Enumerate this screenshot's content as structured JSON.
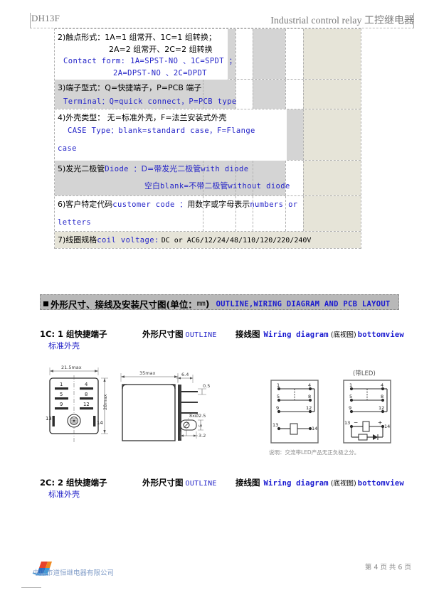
{
  "header": {
    "model": "DH13F",
    "title_en": "Industrial control relay",
    "title_cn": "工控继电器"
  },
  "spec_table": {
    "rows": [
      {
        "id": "contact-form",
        "cn_line1": "2)触点形式：1A=1 组常开、1C=1 组转换；",
        "cn_line2": "2A=2 组常开、2C=2 组转换",
        "en_line1": "Contact form:  1A=SPST-NO 、1C=SPDT ；",
        "en_line2": "2A=DPST-NO 、2C=DPDT"
      },
      {
        "id": "terminal-type",
        "cn_line1": "3)端子型式：Q=快捷端子，P=PCB 端子",
        "en_line1": "Terminal：Q=quick connect，P=PCB type"
      },
      {
        "id": "case-type",
        "cn_line1": "4)外壳类型： 无=标准外壳，F=法兰安装式外壳",
        "en_line1": "CASE Type：blank=standard case，F=Flange",
        "en_line2": "case"
      },
      {
        "id": "diode",
        "cn_line1": "5)发光二极管",
        "en_inline1": "Diode ：",
        "cn_line1b": "D=带发光二极管",
        "en_inline2": "with diode",
        "cn_line2": "空白",
        "en_line2a": "blank=",
        "cn_line2b": "不带二极管",
        "en_line2b": "without diode"
      },
      {
        "id": "customer-code",
        "cn_line1": "6)客户特定代码",
        "en_inline1": "customer code ：",
        "cn_line1b": "用数字或字母表示",
        "en_inline2": "numbers or",
        "en_line2": "letters"
      },
      {
        "id": "coil-voltage",
        "cn_line1": "7)线圈规格",
        "en_inline1": "coil voltage:",
        "en_inline2": "DC or AC6/12/24/48/110/120/220/240V"
      }
    ]
  },
  "section_bar": {
    "cn_title": "外形尺寸、接线及安装尺寸图",
    "unit": "(单位：",
    "unit_mm": "mm",
    "unit_close": ")",
    "en_title": "OUTLINE,WIRING DIAGRAM AND PCB LAYOUT"
  },
  "variants": [
    {
      "id": "1c",
      "code": "1C: 1 组快捷端子",
      "sub": "标准外壳",
      "outline_cn": "外形尺寸图",
      "outline_en": "OUTLINE",
      "wiring_cn": "接线图",
      "wiring_en": "Wiring diagram",
      "wiring_cn2": "(底视图)",
      "wiring_en2": "bottomview"
    },
    {
      "id": "2c",
      "code": "2C: 2 组快捷端子",
      "sub": "标准外壳",
      "outline_cn": "外形尺寸图",
      "outline_en": "OUTLINE",
      "wiring_cn": "接线图",
      "wiring_en": "Wiring diagram",
      "wiring_cn2": "(底视图)",
      "wiring_en2": "bottomview"
    }
  ],
  "drawing": {
    "front_view": {
      "dim_width": "21.5max",
      "dim_height": "28max",
      "terminals": [
        "1",
        "4",
        "5",
        "8",
        "9",
        "12",
        "13",
        "14"
      ]
    },
    "top_view": {
      "dim_width": "35max"
    },
    "side_view": {
      "dim_a": "6.4",
      "dim_b": "0.5",
      "dim_hole": "8xØ2.5",
      "dim_c": "5",
      "dim_d": "3.2"
    },
    "wiring": {
      "led_caption": "(带LED)",
      "terminals": [
        "1",
        "4",
        "5",
        "8",
        "9",
        "12",
        "13",
        "14"
      ],
      "polarity_minus": "−",
      "polarity_plus": "+",
      "note": "说明：交流带LED产品无正负极之分。"
    }
  },
  "footer": {
    "company": "中山市道恒继电器有限公司",
    "page": "第 4 页 共 6 页"
  }
}
